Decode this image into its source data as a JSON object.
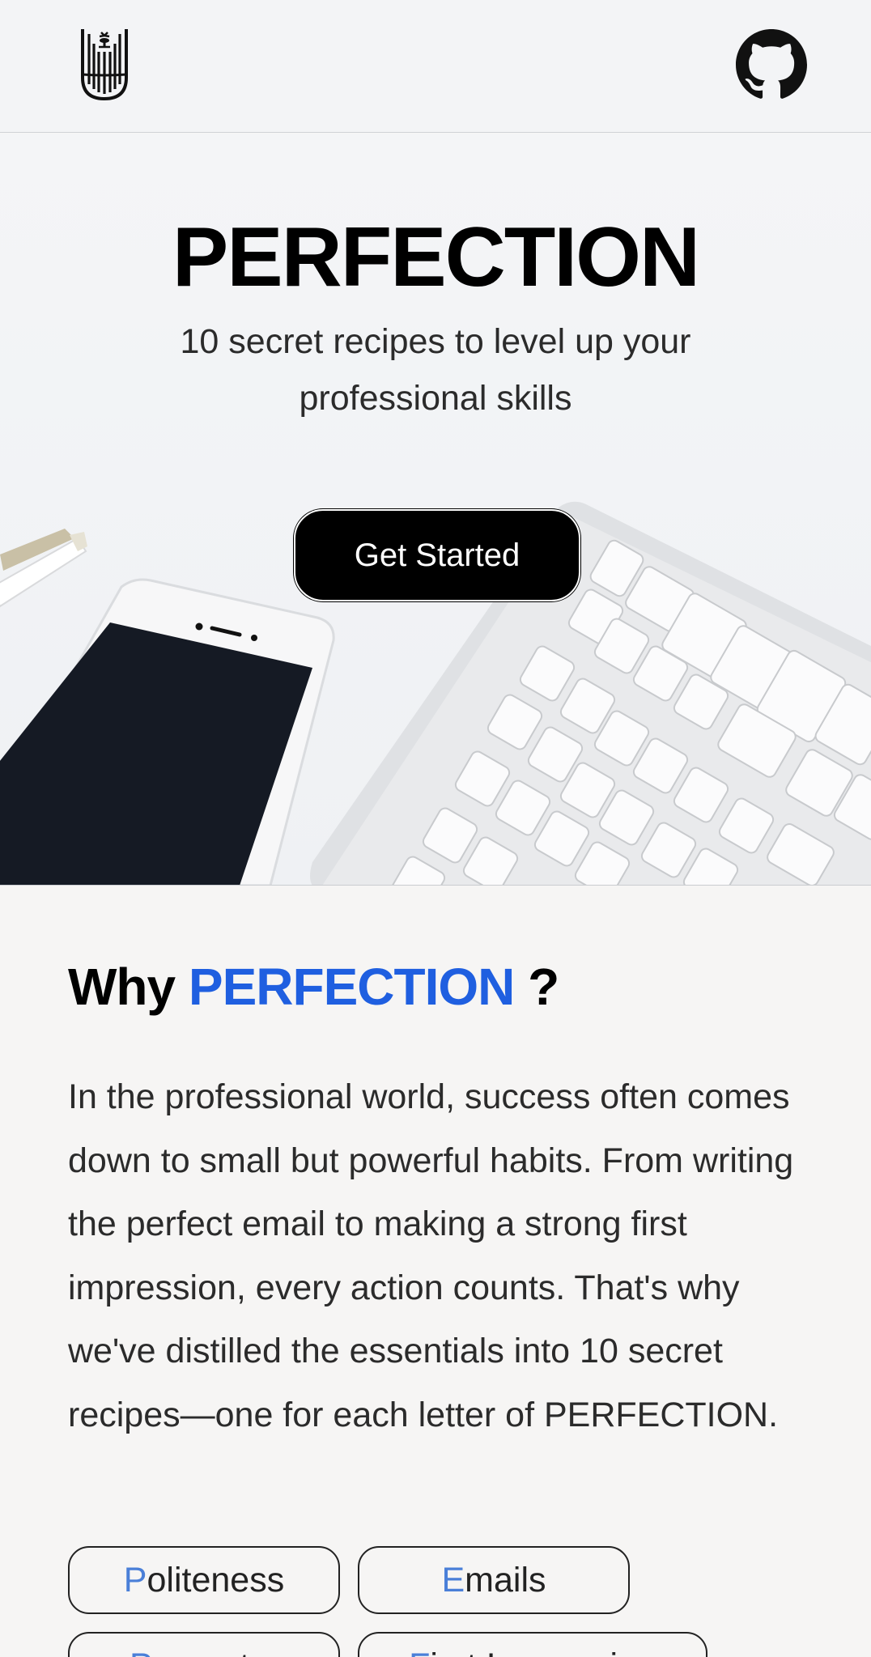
{
  "header": {
    "logo_icon": "palm-tower-logo-icon",
    "github_icon": "github-icon"
  },
  "hero": {
    "title": "PERFECTION",
    "subtitle": "10 secret recipes to level up your professional skills",
    "cta_label": "Get Started"
  },
  "why": {
    "title_prefix": "Why",
    "title_accent": "PERFECTION",
    "title_suffix": "?",
    "body": "In the professional world, success often comes down to small but powerful habits. From writing the perfect email to making a strong first impression, every action counts. That's why we've distilled the essentials into 10 secret recipes—one for each letter of PERFECTION.",
    "accent_color": "#1f5fe0",
    "chips": [
      {
        "first": "P",
        "rest": "oliteness"
      },
      {
        "first": "E",
        "rest": "mails"
      },
      {
        "first": "P",
        "rest": "resent..."
      },
      {
        "first": "F",
        "rest": "irst Impression"
      }
    ]
  }
}
